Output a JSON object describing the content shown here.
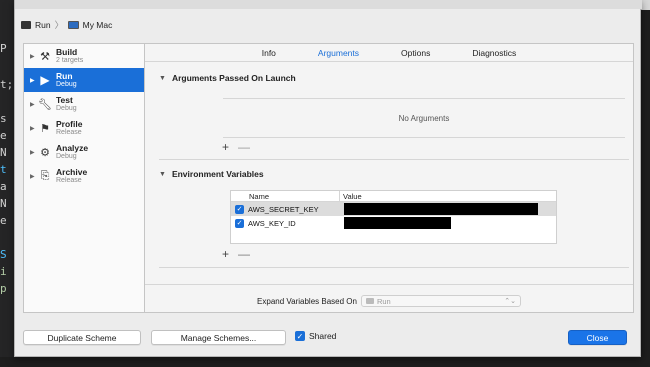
{
  "path": {
    "scheme_label": "Run",
    "destination_label": "My Mac"
  },
  "actions": [
    {
      "title": "Build",
      "subtitle": "2 targets",
      "icon": "hammer-icon",
      "selected": false
    },
    {
      "title": "Run",
      "subtitle": "Debug",
      "icon": "play-icon",
      "selected": true
    },
    {
      "title": "Test",
      "subtitle": "Debug",
      "icon": "wrench-icon",
      "selected": false
    },
    {
      "title": "Profile",
      "subtitle": "Release",
      "icon": "profile-icon",
      "selected": false
    },
    {
      "title": "Analyze",
      "subtitle": "Debug",
      "icon": "analyze-icon",
      "selected": false
    },
    {
      "title": "Archive",
      "subtitle": "Release",
      "icon": "archive-icon",
      "selected": false
    }
  ],
  "tabs": [
    {
      "label": "Info",
      "active": false
    },
    {
      "label": "Arguments",
      "active": true
    },
    {
      "label": "Options",
      "active": false
    },
    {
      "label": "Diagnostics",
      "active": false
    }
  ],
  "arguments": {
    "header": "Arguments Passed On Launch",
    "empty_text": "No Arguments",
    "add": "+",
    "remove": "—"
  },
  "environment": {
    "header": "Environment Variables",
    "col_name": "Name",
    "col_value": "Value",
    "rows": [
      {
        "name": "AWS_SECRET_KEY",
        "enabled": true,
        "value_redacted": true
      },
      {
        "name": "AWS_KEY_ID",
        "enabled": true,
        "value_redacted": true
      }
    ],
    "add": "+",
    "remove": "—"
  },
  "expand": {
    "label": "Expand Variables Based On",
    "value": "Run"
  },
  "footer": {
    "duplicate": "Duplicate Scheme",
    "manage": "Manage Schemes...",
    "shared": "Shared",
    "close": "Close"
  },
  "colors": {
    "accent": "#1a6fd8",
    "selected_row": "#1a6fd8",
    "redaction": "#000000"
  }
}
